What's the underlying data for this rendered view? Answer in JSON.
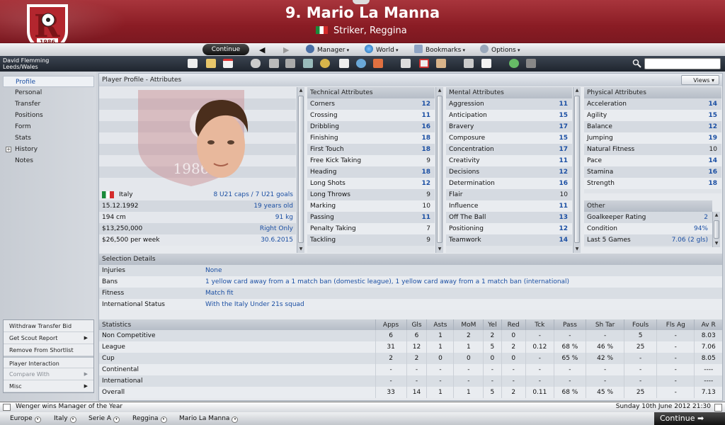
{
  "header": {
    "title": "9. Mario La Manna",
    "subtitle": "Striker, Reggina",
    "crest_year": "1986"
  },
  "navbar": {
    "continue": "Continue",
    "manager": "Manager",
    "world": "World",
    "bookmarks": "Bookmarks",
    "options": "Options"
  },
  "toolbar": {
    "manager_name": "David Flemming",
    "manager_location": "Leeds/Wales",
    "search_placeholder": ""
  },
  "sidebar": {
    "items": [
      {
        "label": "Profile"
      },
      {
        "label": "Personal"
      },
      {
        "label": "Transfer"
      },
      {
        "label": "Positions"
      },
      {
        "label": "Form"
      },
      {
        "label": "Stats"
      },
      {
        "label": "History"
      },
      {
        "label": "Notes"
      }
    ],
    "actions": [
      {
        "label": "Withdraw Transfer Bid"
      },
      {
        "label": "Get Scout Report"
      },
      {
        "label": "Remove From Shortlist"
      },
      {
        "label": "Player Interaction"
      },
      {
        "label": "Compare With"
      },
      {
        "label": "Misc"
      }
    ]
  },
  "panel": {
    "title": "Player Profile - Attributes",
    "views": "Views"
  },
  "profile": {
    "nationality": "Italy",
    "caps": "8 U21 caps / 7 U21 goals",
    "dob": "15.12.1992",
    "age": "19 years old",
    "height": "194 cm",
    "weight": "91 kg",
    "value": "$13,250,000",
    "foot": "Right Only",
    "wage": "$26,500 per week",
    "contract": "30.6.2015"
  },
  "technical": {
    "header": "Technical Attributes",
    "rows": [
      {
        "name": "Corners",
        "value": "12"
      },
      {
        "name": "Crossing",
        "value": "11"
      },
      {
        "name": "Dribbling",
        "value": "16"
      },
      {
        "name": "Finishing",
        "value": "18"
      },
      {
        "name": "First Touch",
        "value": "18"
      },
      {
        "name": "Free Kick Taking",
        "value": "9"
      },
      {
        "name": "Heading",
        "value": "18"
      },
      {
        "name": "Long Shots",
        "value": "12"
      },
      {
        "name": "Long Throws",
        "value": "9"
      },
      {
        "name": "Marking",
        "value": "10"
      },
      {
        "name": "Passing",
        "value": "11"
      },
      {
        "name": "Penalty Taking",
        "value": "7"
      },
      {
        "name": "Tackling",
        "value": "9"
      }
    ]
  },
  "mental": {
    "header": "Mental Attributes",
    "rows": [
      {
        "name": "Aggression",
        "value": "11"
      },
      {
        "name": "Anticipation",
        "value": "15"
      },
      {
        "name": "Bravery",
        "value": "17"
      },
      {
        "name": "Composure",
        "value": "15"
      },
      {
        "name": "Concentration",
        "value": "17"
      },
      {
        "name": "Creativity",
        "value": "11"
      },
      {
        "name": "Decisions",
        "value": "12"
      },
      {
        "name": "Determination",
        "value": "16"
      },
      {
        "name": "Flair",
        "value": "10"
      },
      {
        "name": "Influence",
        "value": "11"
      },
      {
        "name": "Off The Ball",
        "value": "13"
      },
      {
        "name": "Positioning",
        "value": "12"
      },
      {
        "name": "Teamwork",
        "value": "14"
      }
    ]
  },
  "physical": {
    "header": "Physical Attributes",
    "rows": [
      {
        "name": "Acceleration",
        "value": "14"
      },
      {
        "name": "Agility",
        "value": "15"
      },
      {
        "name": "Balance",
        "value": "12"
      },
      {
        "name": "Jumping",
        "value": "19"
      },
      {
        "name": "Natural Fitness",
        "value": "10"
      },
      {
        "name": "Pace",
        "value": "14"
      },
      {
        "name": "Stamina",
        "value": "16"
      },
      {
        "name": "Strength",
        "value": "18"
      }
    ]
  },
  "other": {
    "header": "Other",
    "rows": [
      {
        "name": "Goalkeeper Rating",
        "value": "2"
      },
      {
        "name": "Condition",
        "value": "94%"
      },
      {
        "name": "Last 5 Games",
        "value": "7.06 (2 gls)"
      }
    ]
  },
  "selection": {
    "header": "Selection Details",
    "rows": [
      {
        "name": "Injuries",
        "value": "None"
      },
      {
        "name": "Bans",
        "value": "1 yellow card away from a 1 match ban (domestic league), 1 yellow card away from a 1 match ban (international)"
      },
      {
        "name": "Fitness",
        "value": "Match fit"
      },
      {
        "name": "International Status",
        "value": "With the Italy Under 21s squad"
      }
    ]
  },
  "stats": {
    "columns": [
      "Statistics",
      "Apps",
      "Gls",
      "Asts",
      "MoM",
      "Yel",
      "Red",
      "Tck",
      "Pass",
      "Sh Tar",
      "Fouls",
      "Fls Ag",
      "Av R"
    ],
    "rows": [
      [
        "Non Competitive",
        "6",
        "6",
        "1",
        "2",
        "2",
        "0",
        "-",
        "-",
        "-",
        "5",
        "-",
        "8.03"
      ],
      [
        "League",
        "31",
        "12",
        "1",
        "1",
        "5",
        "2",
        "0.12",
        "68 %",
        "46 %",
        "25",
        "-",
        "7.06"
      ],
      [
        "Cup",
        "2",
        "2",
        "0",
        "0",
        "0",
        "0",
        "-",
        "65 %",
        "42 %",
        "-",
        "-",
        "8.05"
      ],
      [
        "Continental",
        "-",
        "-",
        "-",
        "-",
        "-",
        "-",
        "-",
        "-",
        "-",
        "-",
        "-",
        "----"
      ],
      [
        "International",
        "-",
        "-",
        "-",
        "-",
        "-",
        "-",
        "-",
        "-",
        "-",
        "-",
        "-",
        "----"
      ],
      [
        "Overall",
        "33",
        "14",
        "1",
        "1",
        "5",
        "2",
        "0.11",
        "68 %",
        "45 %",
        "25",
        "-",
        "7.13"
      ]
    ]
  },
  "status": {
    "news": "Wenger wins Manager of the Year",
    "datetime": "Sunday 10th June 2012 21:30"
  },
  "breadcrumbs": [
    "Europe",
    "Italy",
    "Serie A",
    "Reggina",
    "Mario La Manna"
  ],
  "bottom": {
    "continue": "Continue"
  },
  "colors": {
    "header_red": "#8a1c24",
    "link_blue": "#1b4fa3",
    "toolbar_dark": "#2a313b"
  }
}
